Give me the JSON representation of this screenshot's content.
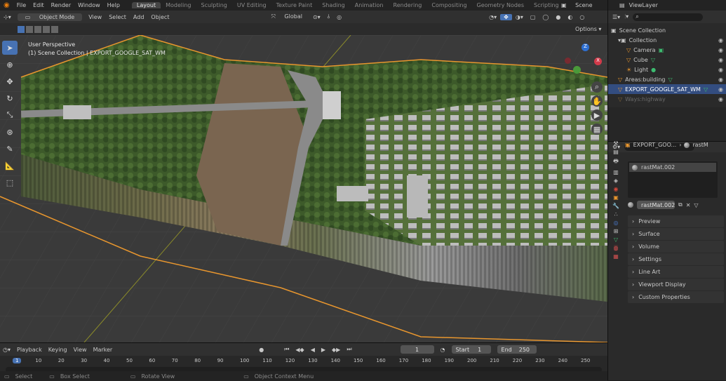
{
  "menu": {
    "items": [
      "File",
      "Edit",
      "Render",
      "Window",
      "Help"
    ]
  },
  "workspaces": [
    "Layout",
    "Modeling",
    "Sculpting",
    "UV Editing",
    "Texture Paint",
    "Shading",
    "Animation",
    "Rendering",
    "Compositing",
    "Geometry Nodes",
    "Scripting"
  ],
  "scene_label": "Scene",
  "view_layer_label": "ViewLayer",
  "viewport_header": {
    "mode": "Object Mode",
    "menus": [
      "View",
      "Select",
      "Add",
      "Object"
    ],
    "transform": "Global",
    "options": "Options"
  },
  "viewport": {
    "perspective": "User Perspective",
    "collection_info": "(1) Scene Collection | EXPORT_GOOGLE_SAT_WM"
  },
  "outliner": {
    "root": "Scene Collection",
    "items": [
      {
        "label": "Collection",
        "depth": 1
      },
      {
        "label": "Camera",
        "depth": 2
      },
      {
        "label": "Cube",
        "depth": 2
      },
      {
        "label": "Light",
        "depth": 2
      },
      {
        "label": "Areas:building",
        "depth": 1
      },
      {
        "label": "EXPORT_GOOGLE_SAT_WM",
        "depth": 1,
        "selected": true
      },
      {
        "label": "Ways:highway",
        "depth": 1,
        "dim": true
      }
    ]
  },
  "properties": {
    "object_name": "EXPORT_GOO...",
    "material_short": "rastM",
    "slot_material": "rastMat.002",
    "data_block": "rastMat.002",
    "sections": [
      "Preview",
      "Surface",
      "Volume",
      "Settings",
      "Line Art",
      "Viewport Display",
      "Custom Properties"
    ]
  },
  "timeline": {
    "menus": [
      "Playback",
      "Keying",
      "View",
      "Marker"
    ],
    "current_frame": "1",
    "start_label": "Start",
    "start": "1",
    "end_label": "End",
    "end": "250",
    "ticks": [
      "1",
      "10",
      "20",
      "30",
      "40",
      "50",
      "60",
      "70",
      "80",
      "90",
      "100",
      "110",
      "120",
      "130",
      "140",
      "150",
      "160",
      "170",
      "180",
      "190",
      "200",
      "210",
      "220",
      "230",
      "240",
      "250"
    ]
  },
  "status_bar": {
    "select": "Select",
    "box_select": "Box Select",
    "rotate_view": "Rotate View",
    "context_menu": "Object Context Menu"
  },
  "colors": {
    "accent": "#4772b3",
    "selection_outline": "#e8962e",
    "panel_bg": "#2a2a2a",
    "selected_row": "#334d80"
  }
}
